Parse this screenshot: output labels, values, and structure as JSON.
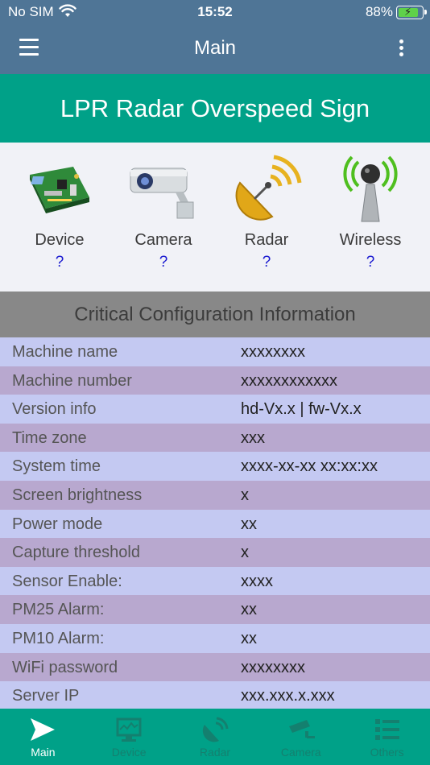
{
  "status_bar": {
    "carrier": "No SIM",
    "time": "15:52",
    "battery": "88%"
  },
  "app_bar": {
    "title": "Main"
  },
  "banner": {
    "title": "LPR Radar Overspeed Sign"
  },
  "modules": [
    {
      "label": "Device",
      "status": "?",
      "icon": "circuit-board-icon"
    },
    {
      "label": "Camera",
      "status": "?",
      "icon": "security-camera-icon"
    },
    {
      "label": "Radar",
      "status": "?",
      "icon": "radar-dish-icon"
    },
    {
      "label": "Wireless",
      "status": "?",
      "icon": "antenna-icon"
    }
  ],
  "config": {
    "title": "Critical Configuration Information",
    "rows": [
      {
        "key": "Machine name",
        "value": "xxxxxxxx"
      },
      {
        "key": "Machine number",
        "value": "xxxxxxxxxxxx"
      },
      {
        "key": "Version info",
        "value": "hd-Vx.x | fw-Vx.x"
      },
      {
        "key": "Time zone",
        "value": "xxx"
      },
      {
        "key": "System time",
        "value": "xxxx-xx-xx xx:xx:xx"
      },
      {
        "key": "Screen brightness",
        "value": "x"
      },
      {
        "key": "Power mode",
        "value": "xx"
      },
      {
        "key": "Capture threshold",
        "value": "x"
      },
      {
        "key": "Sensor Enable:",
        "value": "xxxx"
      },
      {
        "key": "PM25 Alarm:",
        "value": "xx"
      },
      {
        "key": "PM10 Alarm:",
        "value": "xx"
      },
      {
        "key": "WiFi password",
        "value": "xxxxxxxx"
      },
      {
        "key": "Server IP",
        "value": "xxx.xxx.x.xxx"
      }
    ]
  },
  "tabs": [
    {
      "label": "Main",
      "icon": "send-icon",
      "active": true
    },
    {
      "label": "Device",
      "icon": "monitor-chart-icon",
      "active": false
    },
    {
      "label": "Radar",
      "icon": "radar-icon",
      "active": false
    },
    {
      "label": "Camera",
      "icon": "camera-icon",
      "active": false
    },
    {
      "label": "Others",
      "icon": "list-icon",
      "active": false
    }
  ],
  "colors": {
    "header": "#4f7596",
    "accent": "#00a188",
    "row_odd": "#c4c9f2",
    "row_even": "#b8a8cf"
  }
}
